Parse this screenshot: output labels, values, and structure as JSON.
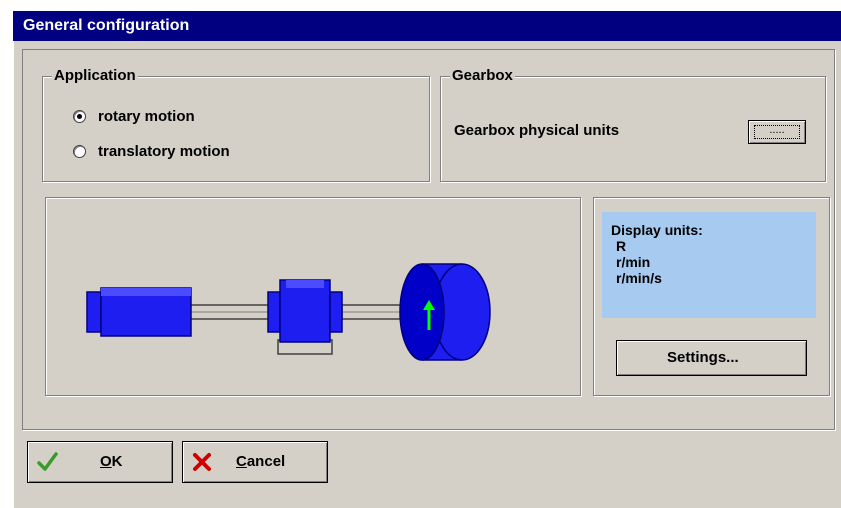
{
  "window": {
    "title": "General configuration"
  },
  "application": {
    "label": "Application",
    "options": [
      {
        "label": "rotary motion",
        "selected": true
      },
      {
        "label": "translatory motion",
        "selected": false
      }
    ]
  },
  "gearbox": {
    "label": "Gearbox",
    "physical_units_label": "Gearbox physical units",
    "button_label": "....."
  },
  "display_units": {
    "title": "Display units:",
    "values": [
      "R",
      "r/min",
      "r/min/s"
    ],
    "settings_button": "Settings..."
  },
  "buttons": {
    "ok": {
      "mnemonic": "O",
      "rest": "K"
    },
    "cancel": {
      "mnemonic": "C",
      "rest": "ancel"
    }
  },
  "colors": {
    "title_bar": "#000080",
    "motor_blue": "#1e1ef0",
    "display_bg": "#a6caf0",
    "arrow_green": "#00ff00",
    "ok_check": "#3a9b2a",
    "cancel_x": "#cc0000"
  }
}
